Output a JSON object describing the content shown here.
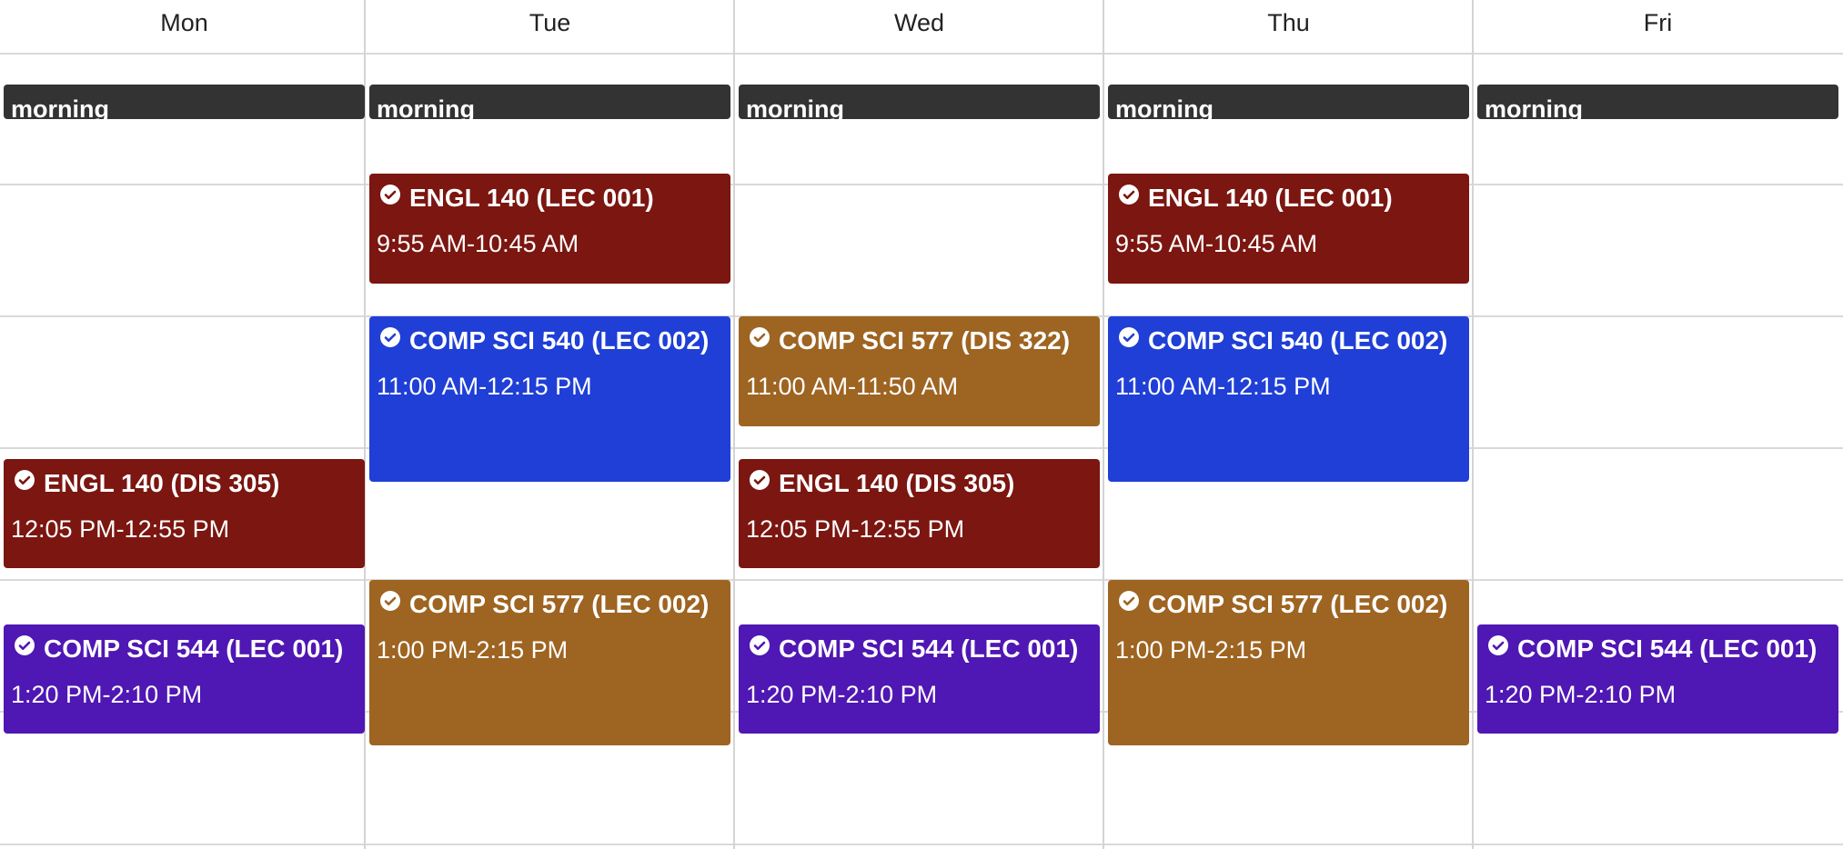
{
  "days": [
    {
      "name": "Mon",
      "morning_label": "morning",
      "events": [
        {
          "title": "ENGL 140 (DIS 305)",
          "time": "12:05 PM-12:55 PM",
          "course": "engl"
        },
        {
          "title": "COMP SCI 544 (LEC 001)",
          "time": "1:20 PM-2:10 PM",
          "course": "cs544"
        }
      ]
    },
    {
      "name": "Tue",
      "morning_label": "morning",
      "events": [
        {
          "title": "ENGL 140 (LEC 001)",
          "time": "9:55 AM-10:45 AM",
          "course": "engl"
        },
        {
          "title": "COMP SCI 540 (LEC 002)",
          "time": "11:00 AM-12:15 PM",
          "course": "cs540"
        },
        {
          "title": "COMP SCI 577 (LEC 002)",
          "time": "1:00 PM-2:15 PM",
          "course": "cs577"
        }
      ]
    },
    {
      "name": "Wed",
      "morning_label": "morning",
      "events": [
        {
          "title": "COMP SCI 577 (DIS 322)",
          "time": "11:00 AM-11:50 AM",
          "course": "cs577"
        },
        {
          "title": "ENGL 140 (DIS 305)",
          "time": "12:05 PM-12:55 PM",
          "course": "engl"
        },
        {
          "title": "COMP SCI 544 (LEC 001)",
          "time": "1:20 PM-2:10 PM",
          "course": "cs544"
        }
      ]
    },
    {
      "name": "Thu",
      "morning_label": "morning",
      "events": [
        {
          "title": "ENGL 140 (LEC 001)",
          "time": "9:55 AM-10:45 AM",
          "course": "engl"
        },
        {
          "title": "COMP SCI 540 (LEC 002)",
          "time": "11:00 AM-12:15 PM",
          "course": "cs540"
        },
        {
          "title": "COMP SCI 577 (LEC 002)",
          "time": "1:00 PM-2:15 PM",
          "course": "cs577"
        }
      ]
    },
    {
      "name": "Fri",
      "morning_label": "morning",
      "events": [
        {
          "title": "COMP SCI 544 (LEC 001)",
          "time": "1:20 PM-2:10 PM",
          "course": "cs544"
        }
      ]
    }
  ],
  "course_colors": {
    "engl": "#7b1610",
    "cs540": "#1f3fd6",
    "cs577": "#9e6421",
    "cs544": "#4f17b3"
  }
}
